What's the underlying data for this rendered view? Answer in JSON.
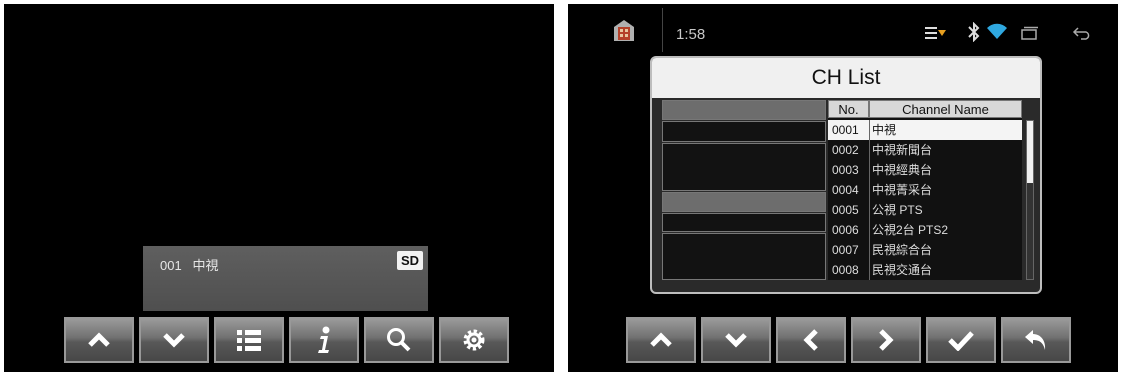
{
  "left_screen": {
    "info_bar": {
      "channel_number": "001",
      "channel_name": "中視",
      "badge": "SD"
    },
    "controls": [
      "up-arrow-icon",
      "down-arrow-icon",
      "list-icon",
      "info-icon",
      "search-icon",
      "settings-icon"
    ]
  },
  "right_screen": {
    "status_bar": {
      "clock": "1:58",
      "icons": [
        "home-icon",
        "menu-icon",
        "bluetooth-icon",
        "wifi-icon",
        "recent-apps-icon",
        "back-icon"
      ]
    },
    "ch_list": {
      "title": "CH List",
      "columns": {
        "no": "No.",
        "name": "Channel Name"
      },
      "rows": [
        {
          "no": "0001",
          "name": "中視",
          "selected": true
        },
        {
          "no": "0002",
          "name": "中視新聞台"
        },
        {
          "no": "0003",
          "name": "中視經典台"
        },
        {
          "no": "0004",
          "name": "中視菁采台"
        },
        {
          "no": "0005",
          "name": "公視 PTS"
        },
        {
          "no": "0006",
          "name": "公視2台 PTS2"
        },
        {
          "no": "0007",
          "name": "民視綜合台"
        },
        {
          "no": "0008",
          "name": "民視交通台"
        }
      ],
      "scroll_fraction": 0.39
    },
    "controls": [
      "up-arrow-icon",
      "down-arrow-icon",
      "left-arrow-icon",
      "right-arrow-icon",
      "check-icon",
      "return-icon"
    ]
  },
  "colors": {
    "background": "#000000",
    "panel": "#2a2a2a",
    "title_bar": "#f0f0f0",
    "selected_row": "#f4f4f4"
  }
}
